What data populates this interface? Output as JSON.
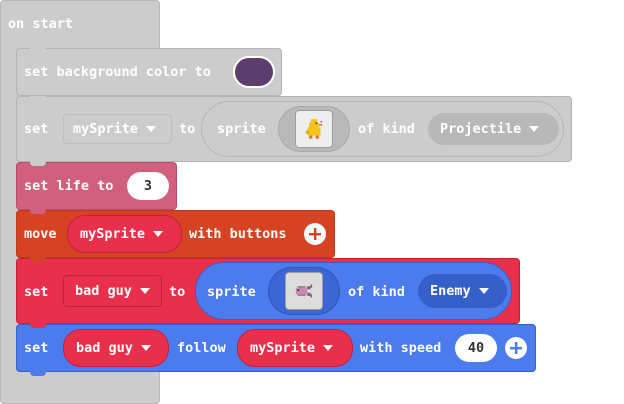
{
  "workspace": {
    "on_start": {
      "label": "on start"
    },
    "set_bg": {
      "label": "set background color to",
      "color": "#5c3d6e"
    },
    "set_sprite": {
      "set_label": "set",
      "var": "mySprite",
      "to_label": "to",
      "sprite_label": "sprite",
      "of_kind_label": "of kind",
      "kind": "Projectile",
      "image_icon": "duck-sprite-icon"
    },
    "set_life": {
      "label": "set life to",
      "value": "3"
    },
    "move": {
      "label": "move",
      "var": "mySprite",
      "suffix": "with buttons"
    },
    "set_bad": {
      "set_label": "set",
      "var": "bad guy",
      "to_label": "to",
      "sprite_label": "sprite",
      "of_kind_label": "of kind",
      "kind": "Enemy",
      "image_icon": "fish-sprite-icon"
    },
    "follow": {
      "set_label": "set",
      "var": "bad guy",
      "follow_label": "follow",
      "target": "mySprite",
      "speed_label": "with speed",
      "speed": "40"
    }
  },
  "colors": {
    "hat": "#cccccc",
    "hat_border": "#b1b1b1",
    "info": "#d63c74",
    "life": "#d1607f",
    "controller": "#d54322",
    "sprites": "#e8304c",
    "sprites_dark": "#c51f3a",
    "blue": "#4b7bec",
    "blue_dark": "#3560c9"
  }
}
